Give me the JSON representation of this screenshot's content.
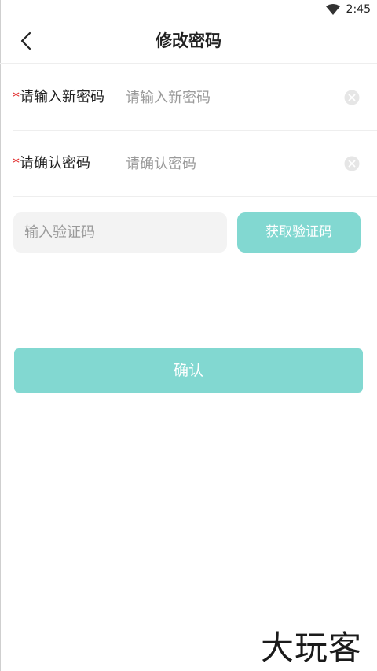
{
  "status_bar": {
    "time": "2:45",
    "wifi_icon": "wifi-icon"
  },
  "nav": {
    "title": "修改密码",
    "back_icon": "chevron-left-icon"
  },
  "form": {
    "required_mark": "*",
    "new_password": {
      "label": "请输入新密码",
      "value": "",
      "placeholder": "请输入新密码",
      "clear_icon": "clear-icon"
    },
    "confirm_password": {
      "label": "请确认密码",
      "value": "",
      "placeholder": "请确认密码",
      "clear_icon": "clear-icon"
    },
    "verification": {
      "value": "",
      "placeholder": "输入验证码",
      "get_code_label": "获取验证码"
    },
    "submit_label": "确认"
  },
  "watermark": "大玩客",
  "colors": {
    "accent": "#82d8d1",
    "required": "#e02020",
    "divider": "#eeeeee",
    "input_bg": "#f3f3f3",
    "placeholder": "#9a9a9a"
  }
}
